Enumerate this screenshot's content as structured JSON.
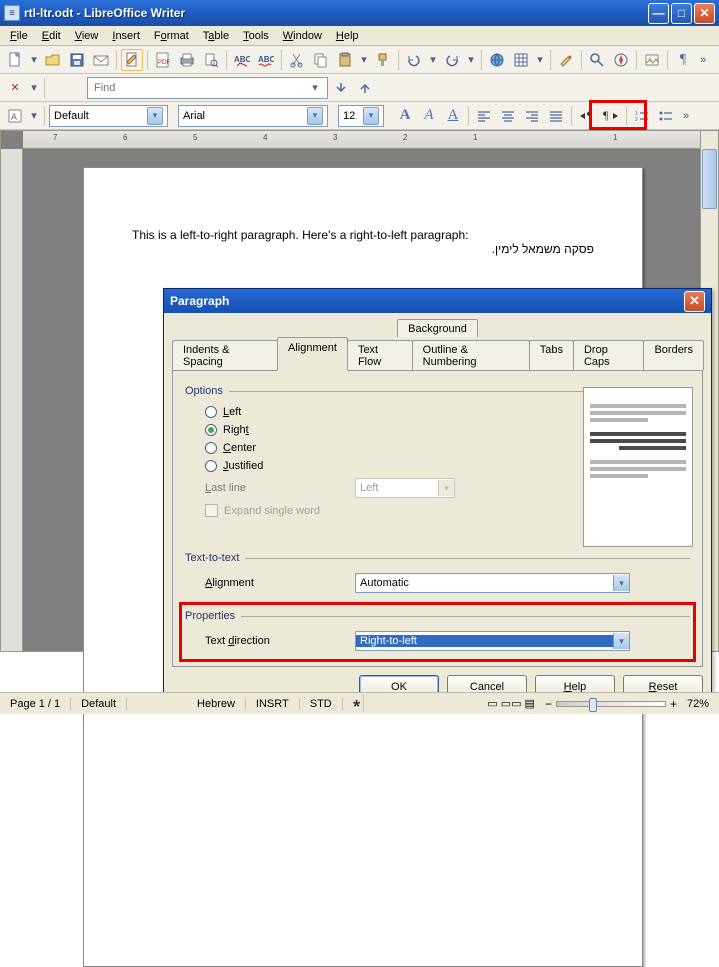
{
  "titlebar": {
    "doc": "rtl-ltr.odt",
    "app": "LibreOffice Writer"
  },
  "menu": [
    "File",
    "Edit",
    "View",
    "Insert",
    "Format",
    "Table",
    "Tools",
    "Window",
    "Help"
  ],
  "find_placeholder": "Find",
  "style_combo": "Default",
  "font_combo": "Arial",
  "size_combo": "12",
  "doc_text_ltr": "This is a left-to-right paragraph. Here's a right-to-left paragraph:",
  "doc_text_rtl": "פסקה משמאל לימין.",
  "dialog": {
    "title": "Paragraph",
    "tabs_top": [
      "Background"
    ],
    "tabs": [
      "Indents & Spacing",
      "Alignment",
      "Text Flow",
      "Outline & Numbering",
      "Tabs",
      "Drop Caps",
      "Borders"
    ],
    "active_tab": "Alignment",
    "options_label": "Options",
    "radios": {
      "left": "Left",
      "right": "Right",
      "center": "Center",
      "justified": "Justified",
      "selected": "right"
    },
    "last_line_label": "Last line",
    "last_line_value": "Left",
    "expand_label": "Expand single word",
    "t2t_label": "Text-to-text",
    "t2t_align_label": "Alignment",
    "t2t_align_value": "Automatic",
    "props_label": "Properties",
    "dir_label": "Text direction",
    "dir_value": "Right-to-left",
    "buttons": {
      "ok": "OK",
      "cancel": "Cancel",
      "help": "Help",
      "reset": "Reset"
    }
  },
  "status": {
    "page": "Page 1 / 1",
    "style": "Default",
    "lang": "Hebrew",
    "insrt": "INSRT",
    "std": "STD",
    "zoom": "72%"
  },
  "ruler": [
    "7",
    "6",
    "5",
    "4",
    "3",
    "2",
    "1",
    "",
    "1"
  ],
  "chart_data": null
}
